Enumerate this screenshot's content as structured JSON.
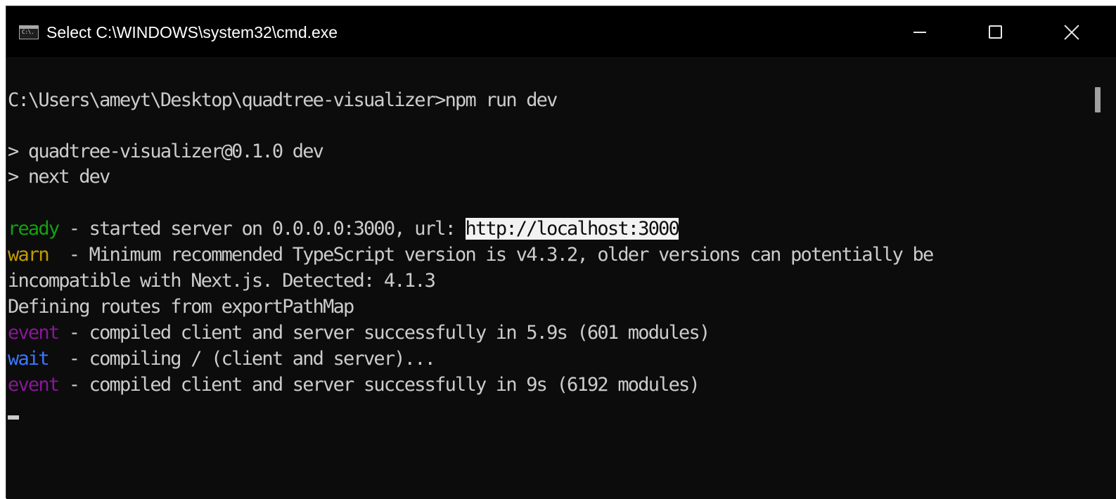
{
  "window": {
    "title": "Select C:\\WINDOWS\\system32\\cmd.exe",
    "icon": "cmd-icon",
    "icon_text": "C:\\.",
    "controls": {
      "minimize": "minimize-icon",
      "maximize": "maximize-icon",
      "close": "close-icon"
    }
  },
  "console": {
    "lines": [
      {
        "text": "C:\\Users\\ameyt\\Desktop\\quadtree-visualizer>npm run dev"
      },
      {
        "text": "> quadtree-visualizer@0.1.0 dev"
      },
      {
        "text": "> next dev"
      },
      {
        "tag": "ready",
        "text": " - started server on 0.0.0.0:3000, url: ",
        "selected": "http://localhost:3000"
      },
      {
        "tag": "warn",
        "text": "  - Minimum recommended TypeScript version is v4.3.2, older versions can potentially be"
      },
      {
        "text": "incompatible with Next.js. Detected: 4.1.3"
      },
      {
        "text": "Defining routes from exportPathMap"
      },
      {
        "tag": "event",
        "text": " - compiled client and server successfully in 5.9s (601 modules)"
      },
      {
        "tag": "wait",
        "text": "  - compiling / (client and server)..."
      },
      {
        "tag": "event",
        "text": " - compiled client and server successfully in 9s (6192 modules)"
      }
    ]
  },
  "colors": {
    "background": "#0c0c0c",
    "foreground": "#cccccc",
    "ready": "#13a10e",
    "warn": "#c19c00",
    "event": "#881798",
    "wait": "#3b78ff",
    "selection": "#f2f2f2"
  }
}
